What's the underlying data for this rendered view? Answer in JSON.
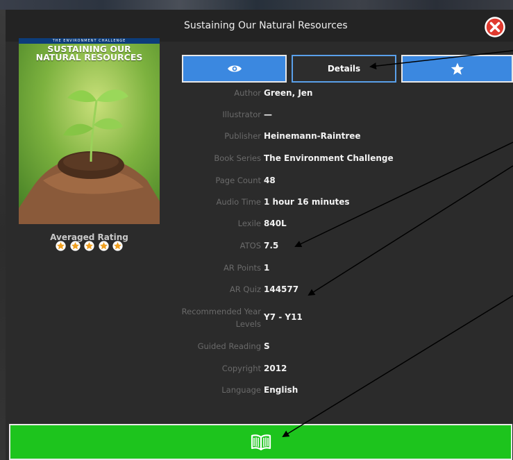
{
  "window": {
    "title": "Sustaining Our Natural Resources"
  },
  "cover": {
    "series_band": "THE ENVIRONMENT CHALLENGE",
    "title": "SUSTAINING OUR\nNATURAL RESOURCES"
  },
  "rating": {
    "label": "Averaged Rating",
    "stars": 5,
    "max": 5
  },
  "tabs": {
    "view_icon": "eye-icon",
    "details_label": "Details",
    "favorite_icon": "star-icon"
  },
  "details": [
    {
      "key": "Author",
      "value": "Green, Jen"
    },
    {
      "key": "Illustrator",
      "value": "—"
    },
    {
      "key": "Publisher",
      "value": "Heinemann-Raintree"
    },
    {
      "key": "Book Series",
      "value": "The Environment Challenge"
    },
    {
      "key": "Page Count",
      "value": "48"
    },
    {
      "key": "Audio Time",
      "value": "1 hour 16 minutes"
    },
    {
      "key": "Lexile",
      "value": "840L"
    },
    {
      "key": "ATOS",
      "value": "7.5"
    },
    {
      "key": "AR Points",
      "value": "1"
    },
    {
      "key": "AR Quiz",
      "value": "144577"
    },
    {
      "key": "Recommended Year Levels",
      "value": "Y7 - Y11"
    },
    {
      "key": "Guided Reading",
      "value": "S"
    },
    {
      "key": "Copyright",
      "value": "2012"
    },
    {
      "key": "Language",
      "value": "English"
    }
  ],
  "read_button": {
    "icon": "open-book-icon"
  },
  "colors": {
    "accent_blue": "#3b88e0",
    "read_green": "#1dc41d",
    "close_red": "#e03a2f",
    "star_orange": "#f0a020"
  }
}
